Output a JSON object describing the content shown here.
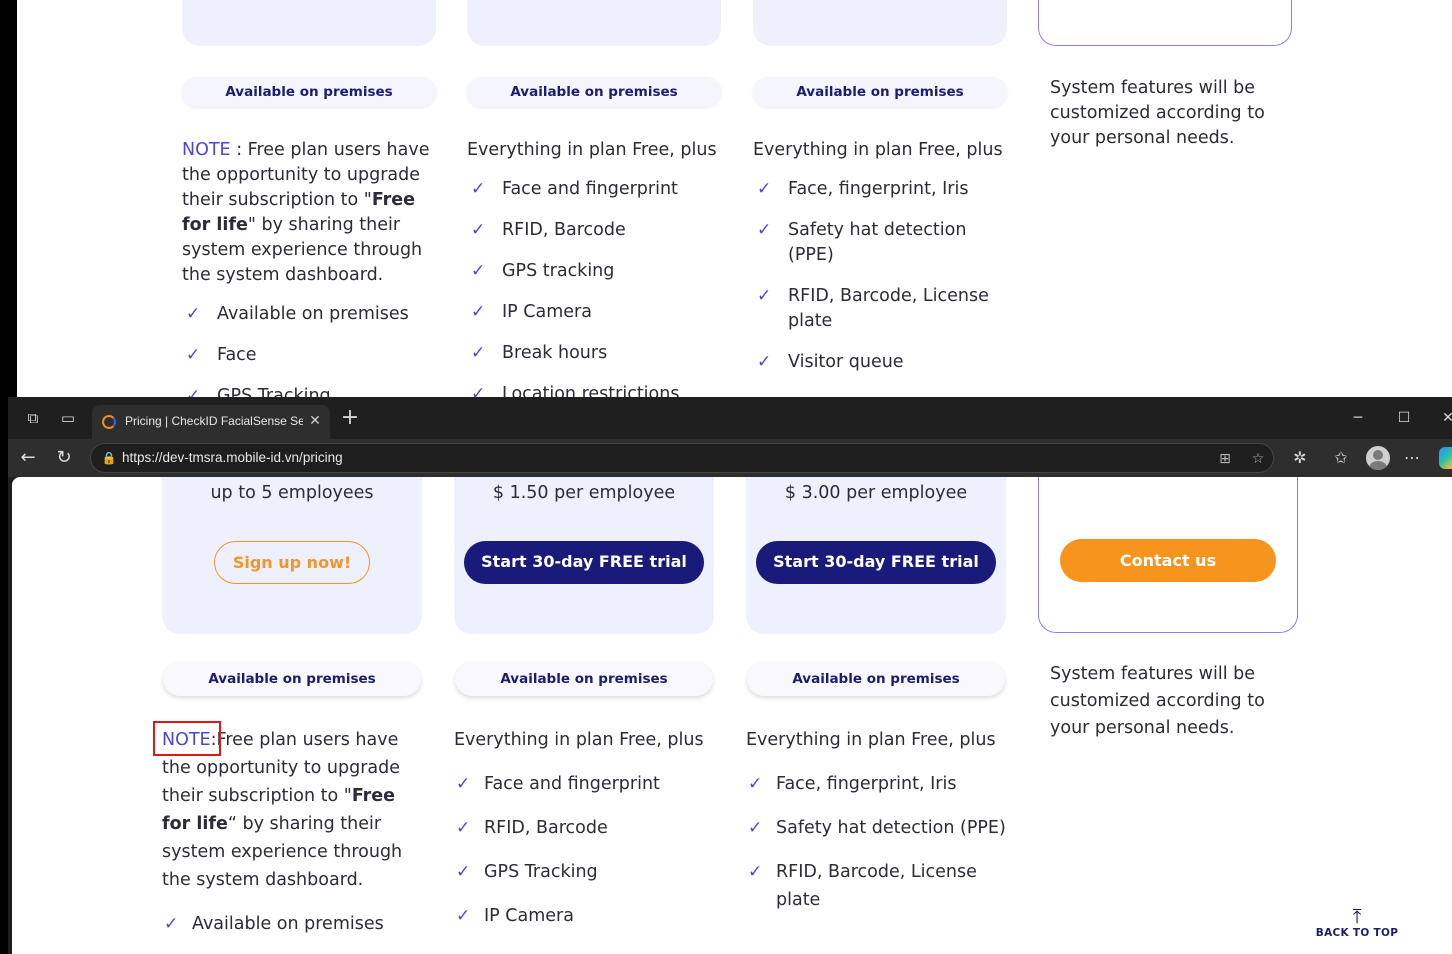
{
  "background_page": {
    "pills": [
      "Available on premises",
      "Available on premises",
      "Available on premises"
    ],
    "free_col": {
      "note_keyword": "NOTE",
      "note_sep": " : ",
      "note_text_1": "Free plan users have the opportunity to upgrade their subscription to \"",
      "note_bold": "Free for life",
      "note_text_2": "\" by sharing their system experience through the system dashboard.",
      "features": [
        "Available on premises",
        "Face",
        "GPS Tracking"
      ]
    },
    "standard_col": {
      "intro": "Everything in plan Free, plus",
      "features": [
        "Face and fingerprint",
        "RFID, Barcode",
        "GPS tracking",
        "IP Camera",
        "Break hours",
        "Location restrictions"
      ]
    },
    "premium_col": {
      "intro": "Everything in plan Free, plus",
      "features": [
        "Face, fingerprint, Iris",
        "Safety hat detection (PPE)",
        "RFID, Barcode, License plate",
        "Visitor queue"
      ]
    },
    "enterprise_text": "System features will be customized according to your personal needs."
  },
  "browser": {
    "tab_title": "Pricing | CheckID FacialSense Serv",
    "url": "https://dev-tmsra.mobile-id.vn/pricing"
  },
  "page": {
    "cards": [
      {
        "price": "up to 5 employees",
        "cta": "Sign up now!"
      },
      {
        "price": "$ 1.50 per employee",
        "cta": "Start 30-day FREE trial"
      },
      {
        "price": "$ 3.00 per employee",
        "cta": "Start 30-day FREE trial"
      }
    ],
    "enterprise_cta": "Contact us",
    "pills": [
      "Available on premises",
      "Available on premises",
      "Available on premises"
    ],
    "free_col": {
      "note_keyword": "NOTE",
      "note_sep": ":",
      "note_text_1": "Free plan users have the opportunity to upgrade their subscription to \"",
      "note_bold": "Free for life",
      "note_text_2": "“ by sharing their system experience through the system dashboard.",
      "features": [
        "Available on premises"
      ]
    },
    "standard_col": {
      "intro": "Everything in plan Free, plus",
      "features": [
        "Face and fingerprint",
        "RFID, Barcode",
        "GPS Tracking",
        "IP Camera"
      ]
    },
    "premium_col": {
      "intro": "Everything in plan Free, plus",
      "features": [
        "Face, fingerprint, Iris",
        "Safety hat detection (PPE)",
        "RFID, Barcode, License plate"
      ]
    },
    "enterprise_text": "System features will be customized according to your personal needs.",
    "back_to_top": "BACK TO TOP"
  },
  "colors": {
    "brand_navy": "#1a1a7a",
    "accent_orange": "#f7941d",
    "accent_purple": "#4b47d6",
    "card_bg": "#eef0fd",
    "highlight_red": "#e01818"
  }
}
